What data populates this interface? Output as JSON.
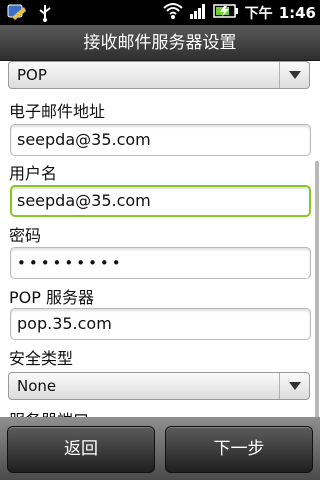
{
  "statusbar": {
    "icons": [
      "android-debug-icon",
      "usb-icon",
      "wifi-icon",
      "signal-icon",
      "battery-icon"
    ],
    "time_prefix": "下午",
    "time": "1:46"
  },
  "header": {
    "title": "接收邮件服务器设置"
  },
  "form": {
    "account_type": "POP",
    "email_label": "电子邮件地址",
    "email_value": "seepda@35.com",
    "username_label": "用户名",
    "username_value": "seepda@35.com",
    "password_label": "密码",
    "password_value": "•••••••••",
    "server_label": "POP 服务器",
    "server_value": "pop.35.com",
    "security_label": "安全类型",
    "security_value": "None",
    "port_label_partial": "服务器端口"
  },
  "footer": {
    "back_label": "返回",
    "next_label": "下一步"
  },
  "colors": {
    "focus": "#88c52a",
    "statusbar": "#000000",
    "titlebar": "#3c3c3c"
  }
}
